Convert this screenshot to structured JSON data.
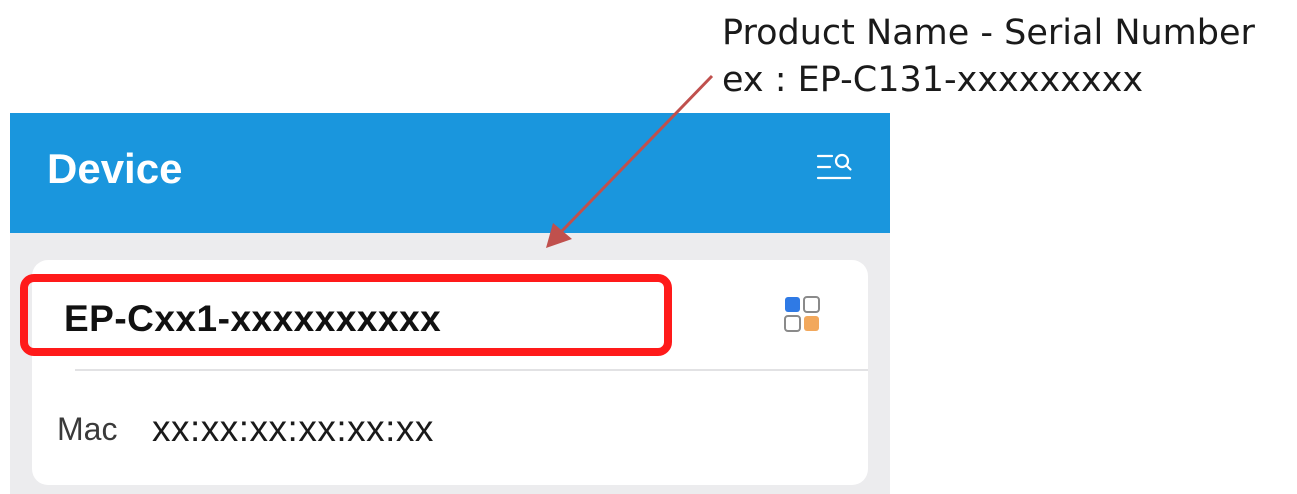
{
  "annotation": {
    "line1": "Product Name - Serial Number",
    "line2": "ex : EP-C131-xxxxxxxxx",
    "arrow_color": "#c0504d"
  },
  "header": {
    "title": "Device",
    "background": "#1a96dd",
    "search_icon": "search-filter-icon"
  },
  "device": {
    "name": "EP-Cxx1-xxxxxxxxxx",
    "highlight_color": "#ff1a1a",
    "grid_icon": "grid-icon",
    "mac_label": "Mac",
    "mac_value": "xx:xx:xx:xx:xx:xx"
  }
}
